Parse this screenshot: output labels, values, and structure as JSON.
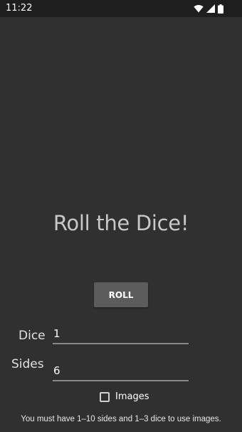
{
  "status_bar": {
    "time": "11:22",
    "icons": [
      "wifi-icon",
      "signal-icon",
      "battery-icon"
    ]
  },
  "main": {
    "title": "Roll the Dice!",
    "roll_button_label": "ROLL",
    "dice_field": {
      "label": "Dice",
      "value": "1"
    },
    "sides_field": {
      "label": "Sides",
      "value": "6"
    },
    "images_checkbox": {
      "label": "Images",
      "checked": false
    },
    "hint": "You must have 1–10 sides and 1–3 dice to use images."
  },
  "colors": {
    "background": "#303030",
    "status_bar": "#1e1e1e",
    "button": "#5c5c5c",
    "title_text": "#c8c8c8"
  }
}
